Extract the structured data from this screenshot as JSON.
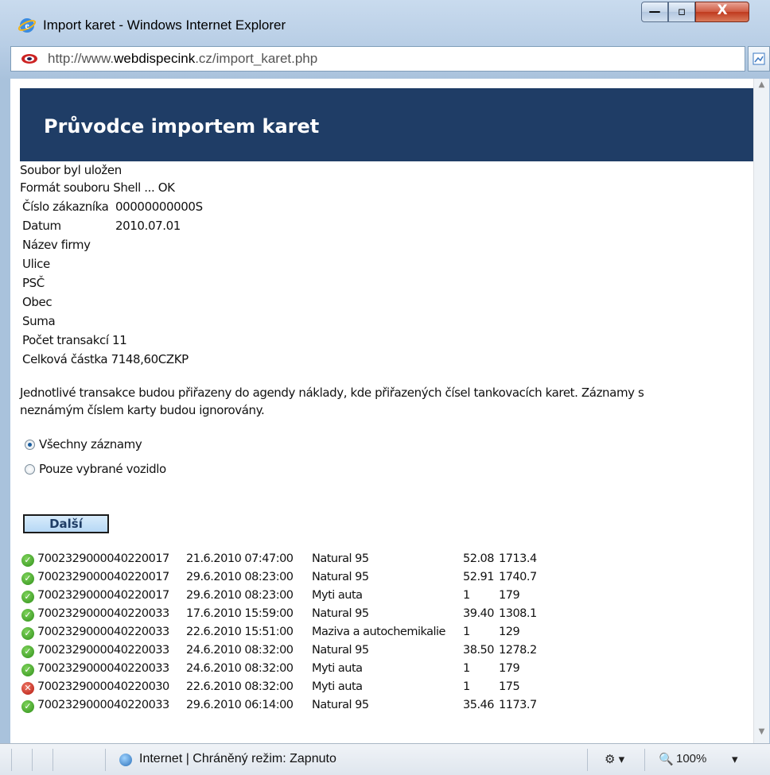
{
  "window": {
    "title": "Import karet - Windows Internet Explorer",
    "min_glyph": "—",
    "max_glyph": "▫",
    "close_glyph": "X"
  },
  "address": {
    "prefix": "http://www.",
    "domain": "webdispecink",
    "suffix": ".cz/import_karet.php"
  },
  "page": {
    "heading": "Průvodce importem karet",
    "status_lines": [
      "Soubor byl uložen",
      "Formát souboru Shell ... OK"
    ],
    "info": [
      {
        "label": "Číslo zákazníka",
        "value": "00000000000S"
      },
      {
        "label": "Datum",
        "value": "2010.07.01"
      },
      {
        "label": "Název firmy",
        "value": ""
      },
      {
        "label": "Ulice",
        "value": ""
      },
      {
        "label": "PSČ",
        "value": ""
      },
      {
        "label": "Obec",
        "value": ""
      },
      {
        "label": "Suma",
        "value": ""
      },
      {
        "label": "Počet transakcí",
        "value": "11"
      },
      {
        "label": "Celková částka",
        "value": "7148,60CZKP"
      }
    ],
    "description_line1": "Jednotlivé transakce budou přiřazeny do agendy náklady, kde přiřazených čísel tankovacích karet. Záznamy s",
    "description_line2": "neznámým číslem karty budou ignorovány.",
    "radio_all": "Všechny záznamy",
    "radio_selected": "Pouze vybrané vozidlo",
    "next_button": "Další"
  },
  "transactions": [
    {
      "status": "ok",
      "card": "7002329000040220017",
      "date": "21.6.2010 07:47:00",
      "product": "Natural 95",
      "qty": "52.08",
      "amount": "1713.4"
    },
    {
      "status": "ok",
      "card": "7002329000040220017",
      "date": "29.6.2010 08:23:00",
      "product": "Natural 95",
      "qty": "52.91",
      "amount": "1740.7"
    },
    {
      "status": "ok",
      "card": "7002329000040220017",
      "date": "29.6.2010 08:23:00",
      "product": "Myti auta",
      "qty": "1",
      "amount": "179"
    },
    {
      "status": "ok",
      "card": "7002329000040220033",
      "date": "17.6.2010 15:59:00",
      "product": "Natural 95",
      "qty": "39.40",
      "amount": "1308.1"
    },
    {
      "status": "ok",
      "card": "7002329000040220033",
      "date": "22.6.2010 15:51:00",
      "product": "Maziva a autochemikalie",
      "qty": "1",
      "amount": "129"
    },
    {
      "status": "ok",
      "card": "7002329000040220033",
      "date": "24.6.2010 08:32:00",
      "product": "Natural 95",
      "qty": "38.50",
      "amount": "1278.2"
    },
    {
      "status": "ok",
      "card": "7002329000040220033",
      "date": "24.6.2010 08:32:00",
      "product": "Myti auta",
      "qty": "1",
      "amount": "179"
    },
    {
      "status": "error",
      "card": "7002329000040220030",
      "date": "22.6.2010 08:32:00",
      "product": "Myti auta",
      "qty": "1",
      "amount": "175"
    },
    {
      "status": "ok",
      "card": "7002329000040220033",
      "date": "29.6.2010 06:14:00",
      "product": "Natural 95",
      "qty": "35.46",
      "amount": "1173.7"
    }
  ],
  "statusbar": {
    "zone_text": "Internet | Chráněný režim: Zapnuto",
    "zoom": "100%"
  },
  "colors": {
    "banner": "#1f3d66",
    "ok_icon": "#2f8f19",
    "error_icon": "#b3170c"
  }
}
